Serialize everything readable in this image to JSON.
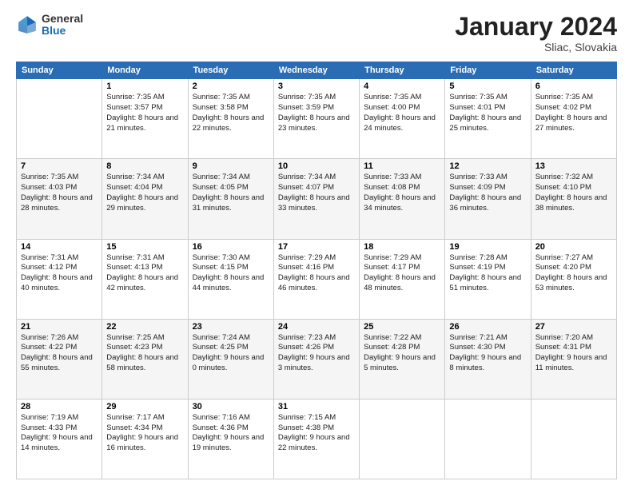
{
  "header": {
    "logo_general": "General",
    "logo_blue": "Blue",
    "title": "January 2024",
    "location": "Sliac, Slovakia"
  },
  "days_of_week": [
    "Sunday",
    "Monday",
    "Tuesday",
    "Wednesday",
    "Thursday",
    "Friday",
    "Saturday"
  ],
  "weeks": [
    [
      {
        "day": "",
        "sunrise": "",
        "sunset": "",
        "daylight": ""
      },
      {
        "day": "1",
        "sunrise": "Sunrise: 7:35 AM",
        "sunset": "Sunset: 3:57 PM",
        "daylight": "Daylight: 8 hours and 21 minutes."
      },
      {
        "day": "2",
        "sunrise": "Sunrise: 7:35 AM",
        "sunset": "Sunset: 3:58 PM",
        "daylight": "Daylight: 8 hours and 22 minutes."
      },
      {
        "day": "3",
        "sunrise": "Sunrise: 7:35 AM",
        "sunset": "Sunset: 3:59 PM",
        "daylight": "Daylight: 8 hours and 23 minutes."
      },
      {
        "day": "4",
        "sunrise": "Sunrise: 7:35 AM",
        "sunset": "Sunset: 4:00 PM",
        "daylight": "Daylight: 8 hours and 24 minutes."
      },
      {
        "day": "5",
        "sunrise": "Sunrise: 7:35 AM",
        "sunset": "Sunset: 4:01 PM",
        "daylight": "Daylight: 8 hours and 25 minutes."
      },
      {
        "day": "6",
        "sunrise": "Sunrise: 7:35 AM",
        "sunset": "Sunset: 4:02 PM",
        "daylight": "Daylight: 8 hours and 27 minutes."
      }
    ],
    [
      {
        "day": "7",
        "sunrise": "Sunrise: 7:35 AM",
        "sunset": "Sunset: 4:03 PM",
        "daylight": "Daylight: 8 hours and 28 minutes."
      },
      {
        "day": "8",
        "sunrise": "Sunrise: 7:34 AM",
        "sunset": "Sunset: 4:04 PM",
        "daylight": "Daylight: 8 hours and 29 minutes."
      },
      {
        "day": "9",
        "sunrise": "Sunrise: 7:34 AM",
        "sunset": "Sunset: 4:05 PM",
        "daylight": "Daylight: 8 hours and 31 minutes."
      },
      {
        "day": "10",
        "sunrise": "Sunrise: 7:34 AM",
        "sunset": "Sunset: 4:07 PM",
        "daylight": "Daylight: 8 hours and 33 minutes."
      },
      {
        "day": "11",
        "sunrise": "Sunrise: 7:33 AM",
        "sunset": "Sunset: 4:08 PM",
        "daylight": "Daylight: 8 hours and 34 minutes."
      },
      {
        "day": "12",
        "sunrise": "Sunrise: 7:33 AM",
        "sunset": "Sunset: 4:09 PM",
        "daylight": "Daylight: 8 hours and 36 minutes."
      },
      {
        "day": "13",
        "sunrise": "Sunrise: 7:32 AM",
        "sunset": "Sunset: 4:10 PM",
        "daylight": "Daylight: 8 hours and 38 minutes."
      }
    ],
    [
      {
        "day": "14",
        "sunrise": "Sunrise: 7:31 AM",
        "sunset": "Sunset: 4:12 PM",
        "daylight": "Daylight: 8 hours and 40 minutes."
      },
      {
        "day": "15",
        "sunrise": "Sunrise: 7:31 AM",
        "sunset": "Sunset: 4:13 PM",
        "daylight": "Daylight: 8 hours and 42 minutes."
      },
      {
        "day": "16",
        "sunrise": "Sunrise: 7:30 AM",
        "sunset": "Sunset: 4:15 PM",
        "daylight": "Daylight: 8 hours and 44 minutes."
      },
      {
        "day": "17",
        "sunrise": "Sunrise: 7:29 AM",
        "sunset": "Sunset: 4:16 PM",
        "daylight": "Daylight: 8 hours and 46 minutes."
      },
      {
        "day": "18",
        "sunrise": "Sunrise: 7:29 AM",
        "sunset": "Sunset: 4:17 PM",
        "daylight": "Daylight: 8 hours and 48 minutes."
      },
      {
        "day": "19",
        "sunrise": "Sunrise: 7:28 AM",
        "sunset": "Sunset: 4:19 PM",
        "daylight": "Daylight: 8 hours and 51 minutes."
      },
      {
        "day": "20",
        "sunrise": "Sunrise: 7:27 AM",
        "sunset": "Sunset: 4:20 PM",
        "daylight": "Daylight: 8 hours and 53 minutes."
      }
    ],
    [
      {
        "day": "21",
        "sunrise": "Sunrise: 7:26 AM",
        "sunset": "Sunset: 4:22 PM",
        "daylight": "Daylight: 8 hours and 55 minutes."
      },
      {
        "day": "22",
        "sunrise": "Sunrise: 7:25 AM",
        "sunset": "Sunset: 4:23 PM",
        "daylight": "Daylight: 8 hours and 58 minutes."
      },
      {
        "day": "23",
        "sunrise": "Sunrise: 7:24 AM",
        "sunset": "Sunset: 4:25 PM",
        "daylight": "Daylight: 9 hours and 0 minutes."
      },
      {
        "day": "24",
        "sunrise": "Sunrise: 7:23 AM",
        "sunset": "Sunset: 4:26 PM",
        "daylight": "Daylight: 9 hours and 3 minutes."
      },
      {
        "day": "25",
        "sunrise": "Sunrise: 7:22 AM",
        "sunset": "Sunset: 4:28 PM",
        "daylight": "Daylight: 9 hours and 5 minutes."
      },
      {
        "day": "26",
        "sunrise": "Sunrise: 7:21 AM",
        "sunset": "Sunset: 4:30 PM",
        "daylight": "Daylight: 9 hours and 8 minutes."
      },
      {
        "day": "27",
        "sunrise": "Sunrise: 7:20 AM",
        "sunset": "Sunset: 4:31 PM",
        "daylight": "Daylight: 9 hours and 11 minutes."
      }
    ],
    [
      {
        "day": "28",
        "sunrise": "Sunrise: 7:19 AM",
        "sunset": "Sunset: 4:33 PM",
        "daylight": "Daylight: 9 hours and 14 minutes."
      },
      {
        "day": "29",
        "sunrise": "Sunrise: 7:17 AM",
        "sunset": "Sunset: 4:34 PM",
        "daylight": "Daylight: 9 hours and 16 minutes."
      },
      {
        "day": "30",
        "sunrise": "Sunrise: 7:16 AM",
        "sunset": "Sunset: 4:36 PM",
        "daylight": "Daylight: 9 hours and 19 minutes."
      },
      {
        "day": "31",
        "sunrise": "Sunrise: 7:15 AM",
        "sunset": "Sunset: 4:38 PM",
        "daylight": "Daylight: 9 hours and 22 minutes."
      },
      {
        "day": "",
        "sunrise": "",
        "sunset": "",
        "daylight": ""
      },
      {
        "day": "",
        "sunrise": "",
        "sunset": "",
        "daylight": ""
      },
      {
        "day": "",
        "sunrise": "",
        "sunset": "",
        "daylight": ""
      }
    ]
  ]
}
